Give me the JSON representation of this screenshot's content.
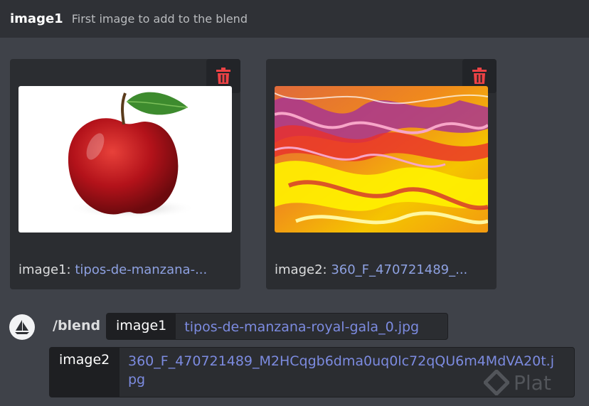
{
  "header": {
    "option_name": "image1",
    "option_description": "First image to add to the blend"
  },
  "attachments": [
    {
      "label_prefix": "image1:",
      "filename_truncated": "tipos-de-manzana-...",
      "delete_icon": "trash-icon",
      "preview": "red apple"
    },
    {
      "label_prefix": "image2:",
      "filename_truncated": "360_F_470721489_...",
      "delete_icon": "trash-icon",
      "preview": "abstract marbled fluid art"
    }
  ],
  "command": {
    "name": "/blend",
    "options": [
      {
        "key": "image1",
        "value": "tipos-de-manzana-royal-gala_0.jpg"
      },
      {
        "key": "image2",
        "value": "360_F_470721489_M2HCqgb6dma0uq0lc72qQU6m4MdVA20t.jpg"
      }
    ]
  },
  "watermark": {
    "text": "Plat"
  },
  "colors": {
    "background": "#3f4249",
    "header": "#2f3136",
    "card": "#2b2d31",
    "link": "#8ea1e1",
    "danger": "#ed4245"
  }
}
